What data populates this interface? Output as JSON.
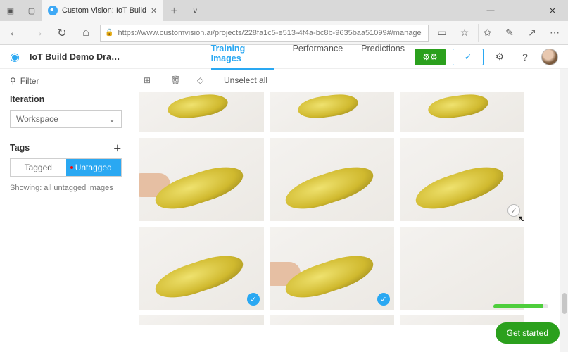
{
  "window": {
    "tab_title": "Custom Vision: IoT Build",
    "url": "https://www.customvision.ai/projects/228fa1c5-e513-4f4a-bc8b-9635baa51099#/manage"
  },
  "header": {
    "project_name": "IoT Build Demo Drag…",
    "tabs": [
      {
        "label": "Training Images",
        "active": true
      },
      {
        "label": "Performance",
        "active": false
      },
      {
        "label": "Predictions",
        "active": false
      }
    ],
    "train_icon": "gears-icon",
    "quick_icon": "check-icon"
  },
  "sidebar": {
    "filter_label": "Filter",
    "iteration_label": "Iteration",
    "iteration_value": "Workspace",
    "tags_label": "Tags",
    "tag_toggle": {
      "tagged": "Tagged",
      "untagged": "Untagged"
    },
    "showing_text": "Showing: all untagged images"
  },
  "toolbar": {
    "unselect_label": "Unselect all"
  },
  "grid": {
    "rows": [
      {
        "h": "short",
        "cells": [
          {
            "banana": "partial"
          },
          {
            "banana": "partial"
          },
          {
            "banana": "partial"
          }
        ]
      },
      {
        "h": "tall",
        "cells": [
          {
            "banana": "full",
            "hand": true
          },
          {
            "banana": "full"
          },
          {
            "banana": "full",
            "hover": true
          }
        ]
      },
      {
        "h": "tall",
        "cells": [
          {
            "banana": "full",
            "selected": true
          },
          {
            "banana": "full",
            "hand": true,
            "selected": true
          },
          {
            "banana": "none"
          }
        ]
      },
      {
        "h": "strip",
        "cells": [
          {},
          {},
          {}
        ]
      }
    ]
  },
  "footer": {
    "get_started": "Get started"
  }
}
